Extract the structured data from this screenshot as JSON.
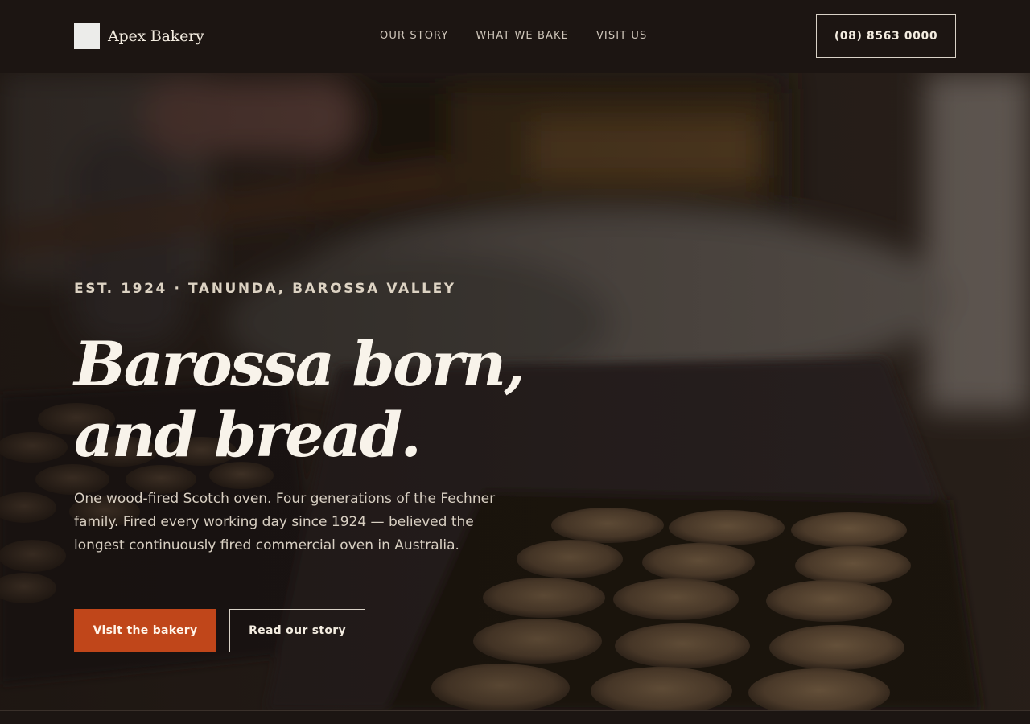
{
  "header": {
    "brand_name": "Apex Bakery",
    "nav": [
      "OUR STORY",
      "WHAT WE BAKE",
      "VISIT US"
    ],
    "phone_label": "(08) 8563 0000"
  },
  "hero": {
    "eyebrow": "EST. 1924 · TANUNDA, BAROSSA VALLEY",
    "headline_line1": "Barossa born,",
    "headline_line2": "and bread.",
    "subtext": "One wood-fired Scotch oven. Four generations of the Fechner family. Fired every working day since 1924 — believed the longest continuously fired commercial oven in Australia.",
    "primary_cta": "Visit the bakery",
    "secondary_cta": "Read our story",
    "image_subject": "bakery-oven-pies-photo"
  },
  "colors": {
    "background": "#1c1512",
    "accent": "#c0461a",
    "text": "#f8f3ea"
  }
}
